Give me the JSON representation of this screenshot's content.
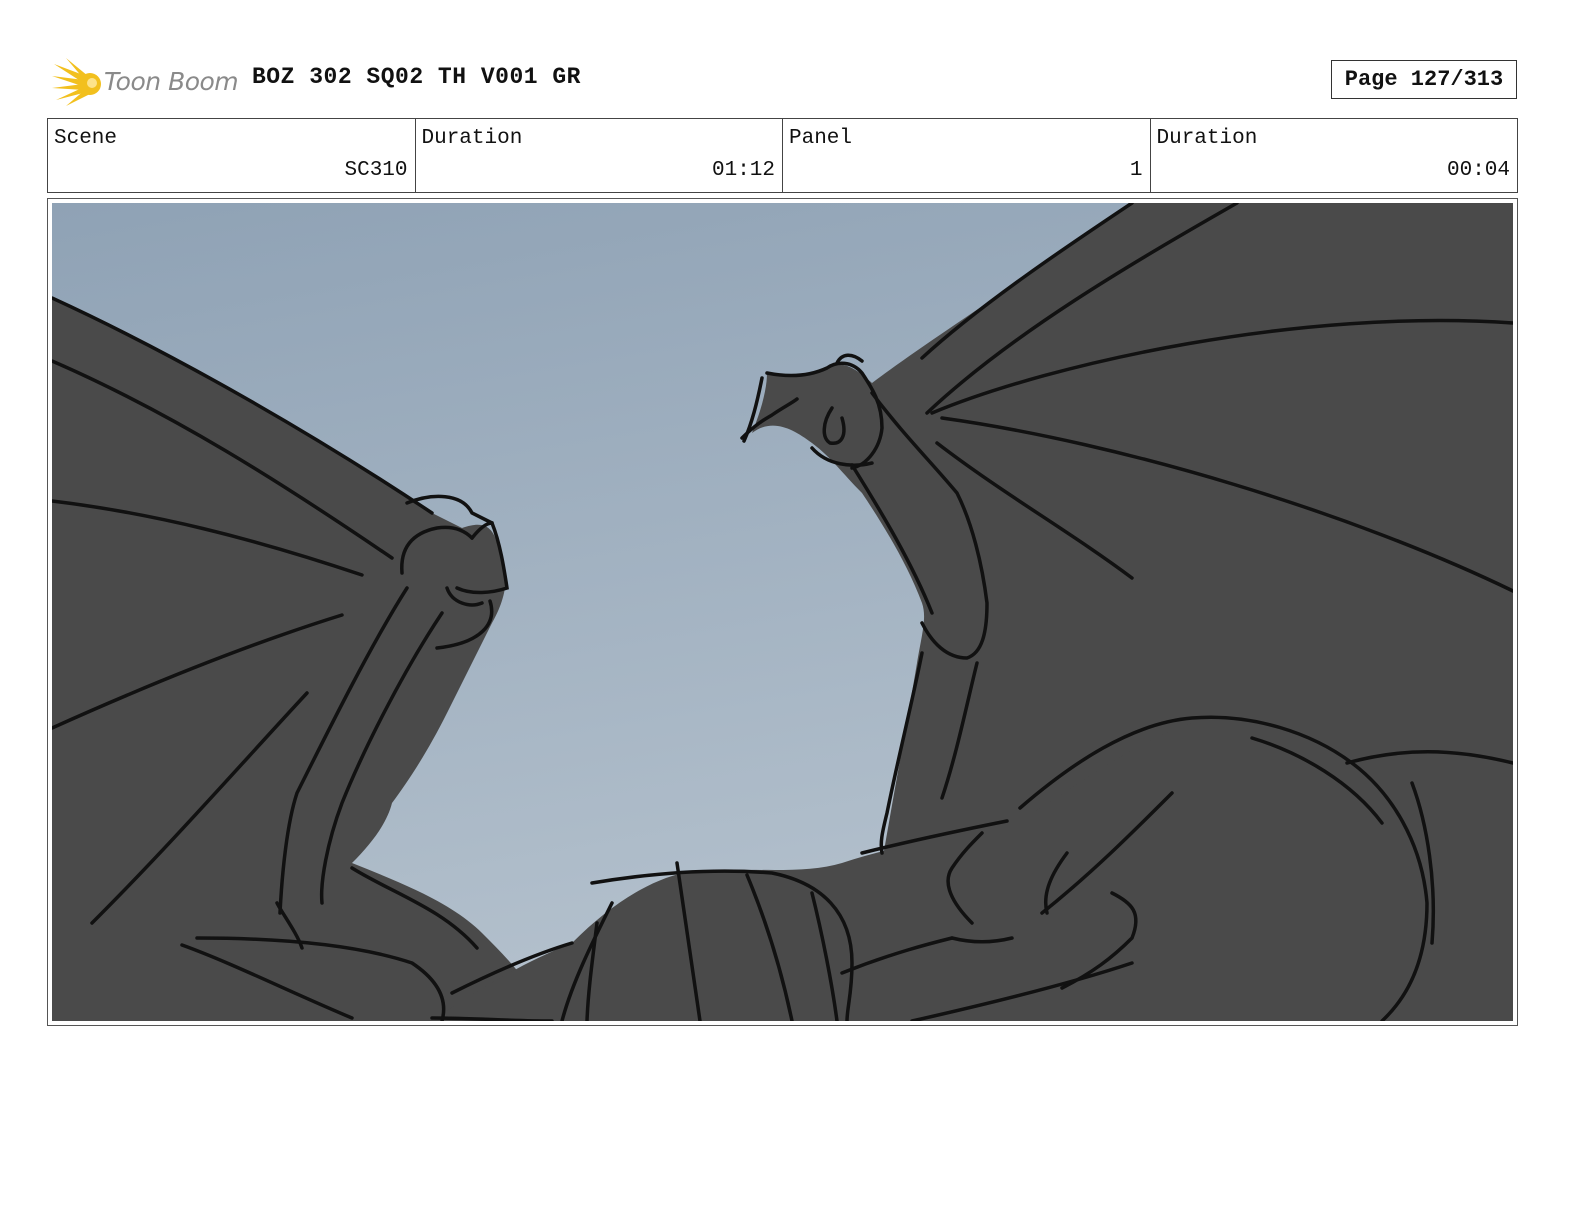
{
  "header": {
    "logo_icon": "toon-boom-burst-icon",
    "logo_text": "Toon Boom",
    "logo_color": "#f2c01e",
    "title": "BOZ 302 SQ02 TH V001 GR",
    "page_label": "Page 127/313"
  },
  "info": {
    "scene_label": "Scene",
    "scene_value": "SC310",
    "scene_duration_label": "Duration",
    "scene_duration_value": "01:12",
    "panel_label": "Panel",
    "panel_value": "1",
    "panel_duration_label": "Duration",
    "panel_duration_value": "00:04"
  },
  "panel": {
    "sky_color_top": "#8fa2b5",
    "sky_color_bottom": "#b4c1cd",
    "silhouette_color": "#4a4a4a"
  }
}
